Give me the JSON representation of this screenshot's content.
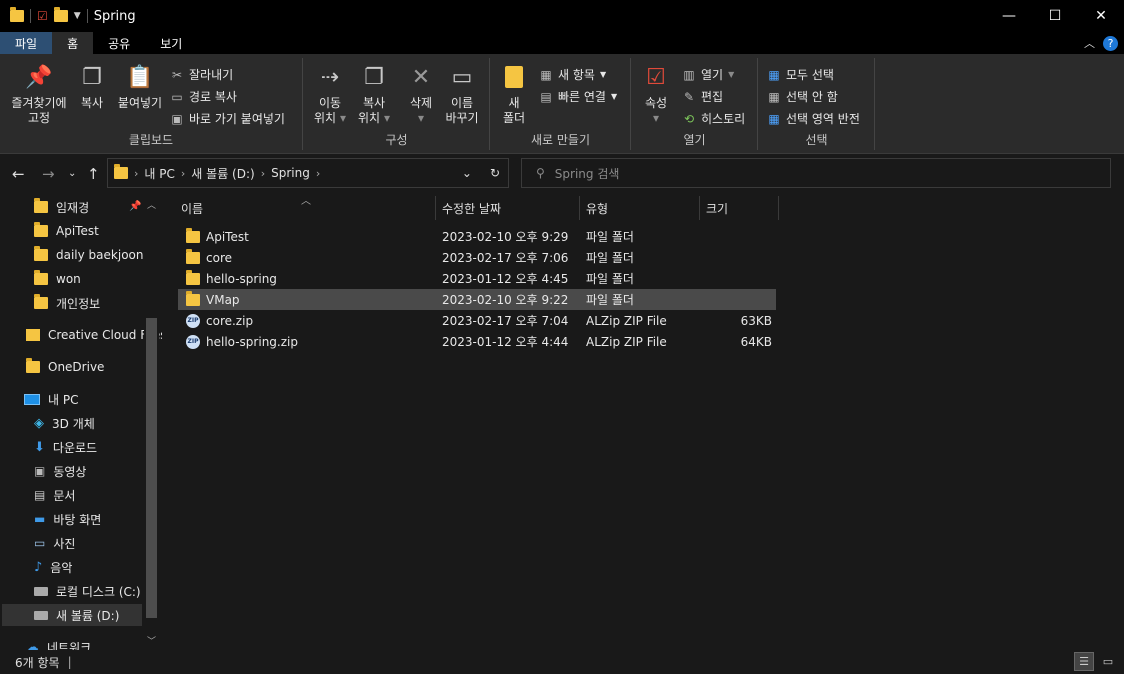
{
  "window": {
    "title": "Spring",
    "controls": [
      "minimize-icon",
      "maximize-icon",
      "close-icon"
    ]
  },
  "ribbon_tabs": [
    "파일",
    "홈",
    "공유",
    "보기"
  ],
  "ribbon": {
    "clipboard": {
      "label": "클립보드",
      "pin_line1": "즐겨찾기에",
      "pin_line2": "고정",
      "copy": "복사",
      "paste": "붙여넣기",
      "cut": "잘라내기",
      "copy_path": "경로 복사",
      "paste_shortcut": "바로 가기 붙여넣기"
    },
    "organize": {
      "label": "구성",
      "move_line1": "이동",
      "move_line2": "위치",
      "copyto_line1": "복사",
      "copyto_line2": "위치",
      "delete": "삭제",
      "rename_line1": "이름",
      "rename_line2": "바꾸기"
    },
    "new": {
      "label": "새로 만들기",
      "newfolder_line1": "새",
      "newfolder_line2": "폴더",
      "new_item": "새 항목",
      "easy_access": "빠른 연결"
    },
    "open": {
      "label": "열기",
      "properties": "속성",
      "open": "열기",
      "edit": "편집",
      "history": "히스토리"
    },
    "select": {
      "label": "선택",
      "select_all": "모두 선택",
      "select_none": "선택 안 함",
      "invert": "선택 영역 반전"
    }
  },
  "address": {
    "crumbs": [
      "내 PC",
      "새 볼륨 (D:)",
      "Spring"
    ],
    "search_placeholder": "Spring 검색"
  },
  "nav": {
    "quick": [
      {
        "label": "임재경",
        "icon": "folder-icon",
        "pinned": true
      },
      {
        "label": "ApiTest",
        "icon": "folder-icon"
      },
      {
        "label": "daily baekjoon",
        "icon": "folder-icon"
      },
      {
        "label": "won",
        "icon": "folder-icon"
      },
      {
        "label": "개인정보",
        "icon": "folder-icon"
      }
    ],
    "creative_cloud": "Creative Cloud Files",
    "onedrive": "OneDrive",
    "this_pc": "내 PC",
    "pc_items": [
      {
        "label": "3D 개체",
        "icon": "cube-icon"
      },
      {
        "label": "다운로드",
        "icon": "download-icon"
      },
      {
        "label": "동영상",
        "icon": "video-icon"
      },
      {
        "label": "문서",
        "icon": "document-icon"
      },
      {
        "label": "바탕 화면",
        "icon": "desktop-icon"
      },
      {
        "label": "사진",
        "icon": "picture-icon"
      },
      {
        "label": "음악",
        "icon": "music-icon"
      },
      {
        "label": "로컬 디스크 (C:)",
        "icon": "drive-icon"
      },
      {
        "label": "새 볼륨 (D:)",
        "icon": "drive-icon",
        "selected": true
      }
    ],
    "network": "네트워크"
  },
  "columns": [
    "이름",
    "수정한 날짜",
    "유형",
    "크기"
  ],
  "files": [
    {
      "name": "ApiTest",
      "date": "2023-02-10 오후 9:29",
      "type": "파일 폴더",
      "size": "",
      "icon": "folder-icon"
    },
    {
      "name": "core",
      "date": "2023-02-17 오후 7:06",
      "type": "파일 폴더",
      "size": "",
      "icon": "folder-icon"
    },
    {
      "name": "hello-spring",
      "date": "2023-01-12 오후 4:45",
      "type": "파일 폴더",
      "size": "",
      "icon": "folder-icon"
    },
    {
      "name": "VMap",
      "date": "2023-02-10 오후 9:22",
      "type": "파일 폴더",
      "size": "",
      "icon": "folder-icon",
      "selected": true
    },
    {
      "name": "core.zip",
      "date": "2023-02-17 오후 7:04",
      "type": "ALZip ZIP File",
      "size": "63KB",
      "icon": "zip-icon"
    },
    {
      "name": "hello-spring.zip",
      "date": "2023-01-12 오후 4:44",
      "type": "ALZip ZIP File",
      "size": "64KB",
      "icon": "zip-icon"
    }
  ],
  "status": {
    "count": "6개 항목"
  },
  "colors": {
    "background": "#191919",
    "ribbon": "#2b2b2b",
    "file_tab": "#2d4f73",
    "folder": "#f5c542",
    "selection": "#4a4a4a"
  }
}
